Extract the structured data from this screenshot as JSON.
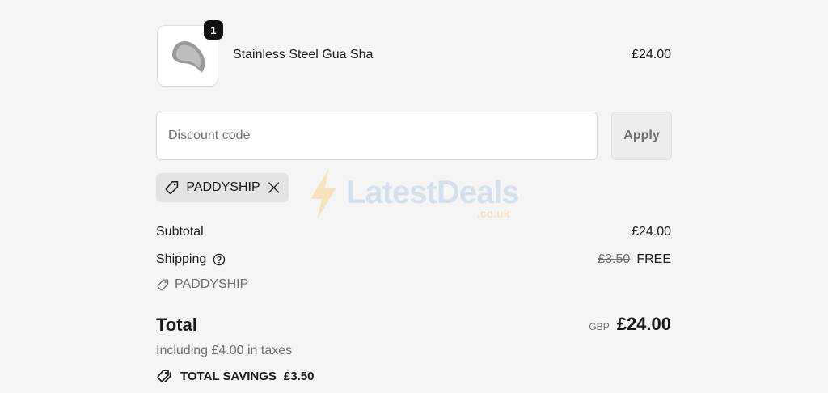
{
  "product": {
    "name": "Stainless Steel Gua Sha",
    "price": "£24.00",
    "quantity": "1",
    "thumbnail_icon": "gua-sha-tool-icon"
  },
  "discount": {
    "placeholder": "Discount code",
    "value": "",
    "apply_label": "Apply",
    "applied_code": "PADDYSHIP"
  },
  "watermark": {
    "text": "LatestDeals",
    "subtext": ".co.uk"
  },
  "summary": {
    "subtotal_label": "Subtotal",
    "subtotal_value": "£24.00",
    "shipping_label": "Shipping",
    "shipping_original": "£3.50",
    "shipping_value": "FREE",
    "shipping_code": "PADDYSHIP",
    "total_label": "Total",
    "currency": "GBP",
    "total_value": "£24.00",
    "tax_note": "Including £4.00 in taxes",
    "savings_label": "TOTAL SAVINGS",
    "savings_value": "£3.50"
  },
  "colors": {
    "background": "#f5f5f5",
    "chip": "#e3e3e3",
    "muted_text": "#6e6e6e"
  }
}
